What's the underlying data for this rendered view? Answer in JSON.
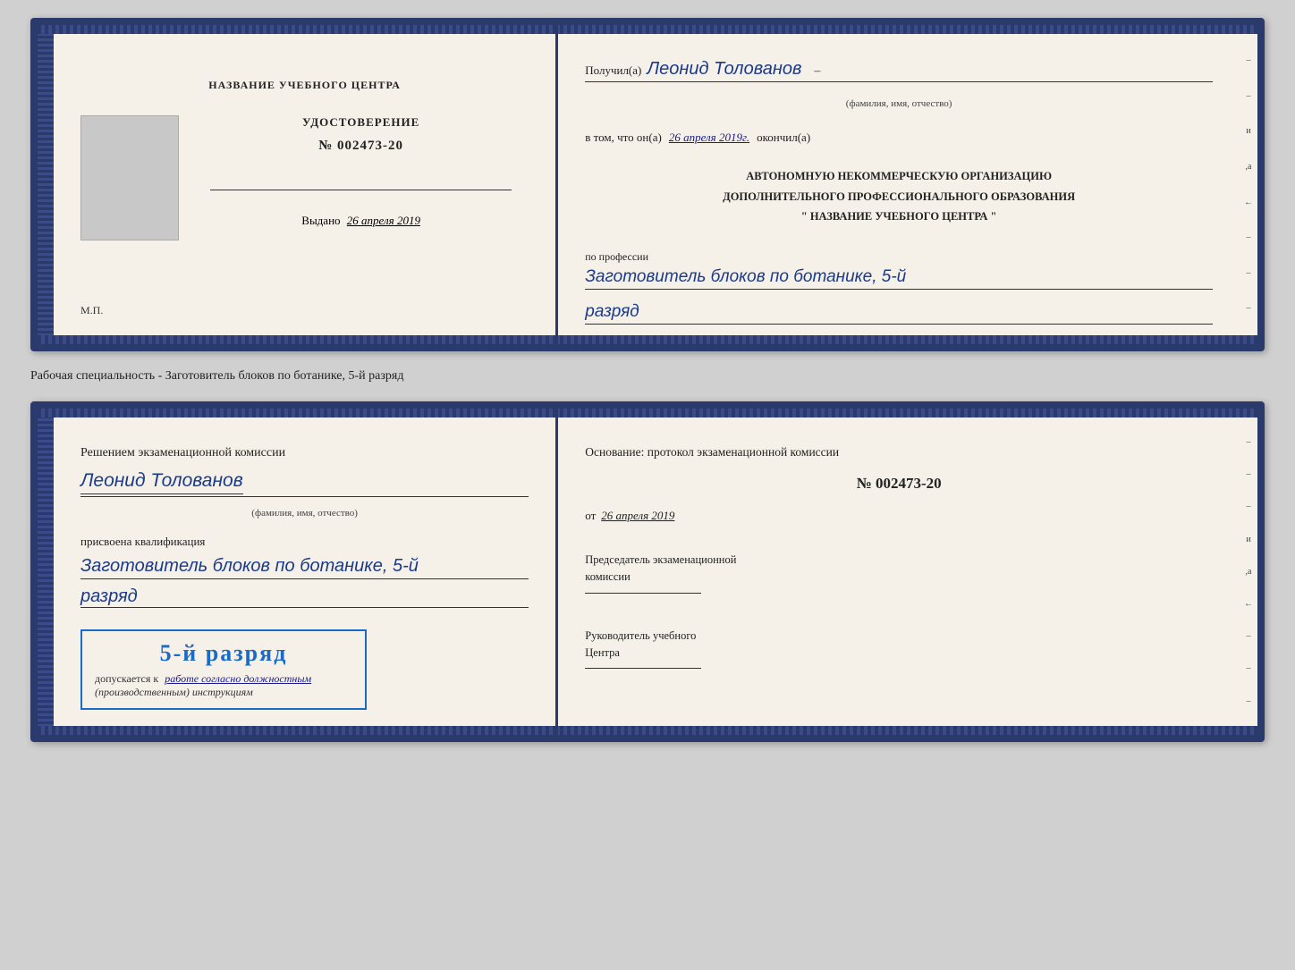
{
  "page": {
    "specialty_label": "Рабочая специальность - Заготовитель блоков по ботанике, 5-й разряд"
  },
  "doc1": {
    "left": {
      "center_title": "НАЗВАНИЕ УЧЕБНОГО ЦЕНТРА",
      "cert_title": "УДОСТОВЕРЕНИЕ",
      "cert_number": "№ 002473-20",
      "issued_label": "Выдано",
      "issued_date": "26 апреля 2019",
      "stamp_label": "М.П."
    },
    "right": {
      "received_label": "Получил(а)",
      "recipient_name": "Леонид Толованов",
      "recipient_subtitle": "(фамилия, имя, отчество)",
      "dash": "–",
      "confirm_text": "в том, что он(а)",
      "confirm_date": "26 апреля 2019г.",
      "finished_label": "окончил(а)",
      "org_line1": "АВТОНОМНУЮ НЕКОММЕРЧЕСКУЮ ОРГАНИЗАЦИЮ",
      "org_line2": "ДОПОЛНИТЕЛЬНОГО ПРОФЕССИОНАЛЬНОГО ОБРАЗОВАНИЯ",
      "org_quote1": "\"",
      "org_name": "НАЗВАНИЕ УЧЕБНОГО ЦЕНТРА",
      "org_quote2": "\"",
      "profession_label": "по профессии",
      "profession_name": "Заготовитель блоков по ботанике, 5-й",
      "rank": "разряд"
    }
  },
  "doc2": {
    "left": {
      "decision_text": "Решением экзаменационной комиссии",
      "person_name": "Леонид Толованов",
      "person_subtitle": "(фамилия, имя, отчество)",
      "assigned_label": "присвоена квалификация",
      "qualification": "Заготовитель блоков по ботанике, 5-й",
      "rank": "разряд",
      "stamp_rank": "5-й разряд",
      "allowed_text": "допускается к",
      "allowed_italic": "работе согласно должностным",
      "instructions": "(производственным) инструкциям"
    },
    "right": {
      "basis_text": "Основание: протокол экзаменационной комиссии",
      "protocol_number": "№  002473-20",
      "date_prefix": "от",
      "date": "26 апреля 2019",
      "chairman_title": "Председатель экзаменационной",
      "chairman_title2": "комиссии",
      "head_title": "Руководитель учебного",
      "head_title2": "Центра"
    }
  }
}
